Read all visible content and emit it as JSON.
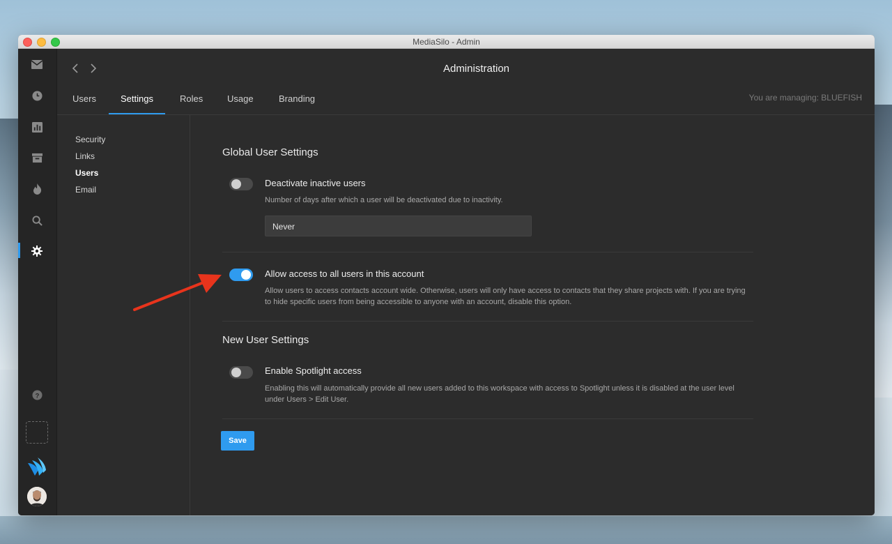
{
  "window": {
    "title": "MediaSilo - Admin"
  },
  "header": {
    "title": "Administration"
  },
  "tabs": [
    {
      "label": "Users",
      "active": false
    },
    {
      "label": "Settings",
      "active": true
    },
    {
      "label": "Roles",
      "active": false
    },
    {
      "label": "Usage",
      "active": false
    },
    {
      "label": "Branding",
      "active": false
    }
  ],
  "managing": "You are managing: BLUEFISH",
  "subnav": [
    {
      "label": "Security",
      "active": false
    },
    {
      "label": "Links",
      "active": false
    },
    {
      "label": "Users",
      "active": true
    },
    {
      "label": "Email",
      "active": false
    }
  ],
  "global_section": {
    "title": "Global User Settings",
    "deactivate": {
      "label": "Deactivate inactive users",
      "description": "Number of days after which a user will be deactivated due to inactivity.",
      "value": "Never",
      "enabled": false
    },
    "allow_access": {
      "label": "Allow access to all users in this account",
      "description": "Allow users to access contacts account wide. Otherwise, users will only have access to contacts that they share projects with. If you are trying to hide specific users from being accessible to anyone with an account, disable this option.",
      "enabled": true
    }
  },
  "new_user_section": {
    "title": "New User Settings",
    "spotlight": {
      "label": "Enable Spotlight access",
      "description": "Enabling this will automatically provide all new users added to this workspace with access to Spotlight unless it is disabled at the user level under Users > Edit User.",
      "enabled": false
    }
  },
  "save_label": "Save",
  "rail_icons": [
    "mail-icon",
    "clock-icon",
    "chart-icon",
    "archive-icon",
    "flame-icon",
    "search-icon",
    "gear-icon",
    "help-icon",
    "brand-logo-icon",
    "user-avatar"
  ],
  "colors": {
    "accent": "#2f9bef",
    "annotation_arrow": "#e8341c",
    "window_bg": "#2c2c2c",
    "rail_bg": "#252525"
  }
}
